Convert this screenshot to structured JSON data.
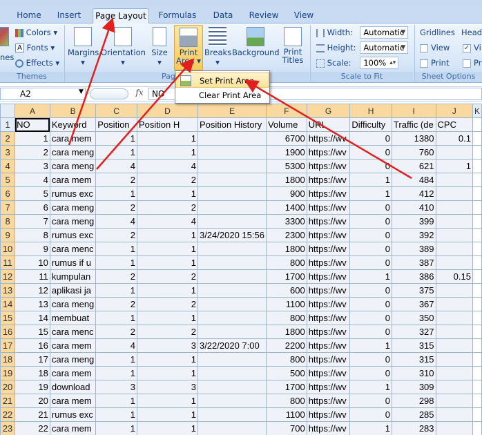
{
  "ribbon_tabs": [
    "Home",
    "Insert",
    "Page Layout",
    "Formulas",
    "Data",
    "Review",
    "View"
  ],
  "themes": {
    "partial_label": "nes",
    "colors": "Colors",
    "fonts": "Fonts",
    "effects": "Effects",
    "group": "Themes"
  },
  "page_setup": {
    "margins": "Margins",
    "orientation": "Orientation",
    "size": "Size",
    "print_area_line1": "Print",
    "print_area_line2": "Area",
    "breaks": "Breaks",
    "background": "Background",
    "print_titles_line1": "Print",
    "print_titles_line2": "Titles",
    "group_partial": "Pag"
  },
  "scale_to_fit": {
    "width_label": "Width:",
    "width_value": "Automatic",
    "height_label": "Height:",
    "height_value": "Automatic",
    "scale_label": "Scale:",
    "scale_value": "100%",
    "group": "Scale to Fit"
  },
  "sheet_options": {
    "gridlines": "Gridlines",
    "headings_partial": "Headi",
    "view": "View",
    "print": "Print",
    "view_partial": "Vi",
    "print_partial": "Pr",
    "group": "Sheet Options"
  },
  "print_area_menu": {
    "set": "Set Print Area",
    "clear": "Clear Print Area"
  },
  "formula_bar": {
    "name_box": "A2",
    "fx": "fx",
    "content": "NO"
  },
  "columns": [
    "A",
    "B",
    "C",
    "D",
    "E",
    "F",
    "G",
    "H",
    "I",
    "J",
    "K"
  ],
  "rows": [
    {
      "n": "1",
      "cells": [
        "NO",
        "Keyword",
        "Position",
        "Position H",
        "Position History",
        "Volume",
        "URL",
        "Difficulty",
        "Traffic (de",
        "CPC",
        ""
      ]
    },
    {
      "n": "2",
      "cells": [
        "1",
        "cara mem",
        "1",
        "1",
        "",
        "6700",
        "https://wv",
        "0",
        "1380",
        "0.1",
        ""
      ]
    },
    {
      "n": "3",
      "cells": [
        "2",
        "cara meng",
        "1",
        "1",
        "",
        "1900",
        "https://wv",
        "0",
        "760",
        "",
        ""
      ]
    },
    {
      "n": "4",
      "cells": [
        "3",
        "cara meng",
        "4",
        "4",
        "",
        "5300",
        "https://wv",
        "0",
        "621",
        "1",
        ""
      ]
    },
    {
      "n": "5",
      "cells": [
        "4",
        "cara mem",
        "2",
        "2",
        "",
        "1800",
        "https://wv",
        "1",
        "484",
        "",
        ""
      ]
    },
    {
      "n": "6",
      "cells": [
        "5",
        "rumus exc",
        "1",
        "1",
        "",
        "900",
        "https://wv",
        "1",
        "412",
        "",
        ""
      ]
    },
    {
      "n": "7",
      "cells": [
        "6",
        "cara meng",
        "2",
        "2",
        "",
        "1400",
        "https://wv",
        "0",
        "410",
        "",
        ""
      ]
    },
    {
      "n": "8",
      "cells": [
        "7",
        "cara meng",
        "4",
        "4",
        "",
        "3300",
        "https://wv",
        "0",
        "399",
        "",
        ""
      ]
    },
    {
      "n": "9",
      "cells": [
        "8",
        "rumus exc",
        "2",
        "1",
        "3/24/2020 15:56",
        "2300",
        "https://wv",
        "0",
        "392",
        "",
        ""
      ]
    },
    {
      "n": "10",
      "cells": [
        "9",
        "cara menc",
        "1",
        "1",
        "",
        "1800",
        "https://wv",
        "0",
        "389",
        "",
        ""
      ]
    },
    {
      "n": "11",
      "cells": [
        "10",
        "rumus if u",
        "1",
        "1",
        "",
        "800",
        "https://wv",
        "0",
        "387",
        "",
        ""
      ]
    },
    {
      "n": "12",
      "cells": [
        "11",
        "kumpulan",
        "2",
        "2",
        "",
        "1700",
        "https://wv",
        "1",
        "386",
        "0.15",
        ""
      ]
    },
    {
      "n": "13",
      "cells": [
        "12",
        "aplikasi ja",
        "1",
        "1",
        "",
        "600",
        "https://wv",
        "0",
        "375",
        "",
        ""
      ]
    },
    {
      "n": "14",
      "cells": [
        "13",
        "cara meng",
        "2",
        "2",
        "",
        "1100",
        "https://wv",
        "0",
        "367",
        "",
        ""
      ]
    },
    {
      "n": "15",
      "cells": [
        "14",
        "membuat",
        "1",
        "1",
        "",
        "800",
        "https://wv",
        "0",
        "350",
        "",
        ""
      ]
    },
    {
      "n": "16",
      "cells": [
        "15",
        "cara menc",
        "2",
        "2",
        "",
        "1800",
        "https://wv",
        "0",
        "327",
        "",
        ""
      ]
    },
    {
      "n": "17",
      "cells": [
        "16",
        "cara mem",
        "4",
        "3",
        "3/22/2020 7:00",
        "2200",
        "https://wv",
        "1",
        "315",
        "",
        ""
      ]
    },
    {
      "n": "18",
      "cells": [
        "17",
        "cara meng",
        "1",
        "1",
        "",
        "800",
        "https://wv",
        "0",
        "315",
        "",
        ""
      ]
    },
    {
      "n": "19",
      "cells": [
        "18",
        "cara mem",
        "1",
        "1",
        "",
        "500",
        "https://wv",
        "0",
        "310",
        "",
        ""
      ]
    },
    {
      "n": "20",
      "cells": [
        "19",
        "download",
        "3",
        "3",
        "",
        "1700",
        "https://wv",
        "1",
        "309",
        "",
        ""
      ]
    },
    {
      "n": "21",
      "cells": [
        "20",
        "cara mem",
        "1",
        "1",
        "",
        "800",
        "https://wv",
        "0",
        "298",
        "",
        ""
      ]
    },
    {
      "n": "22",
      "cells": [
        "21",
        "rumus exc",
        "1",
        "1",
        "",
        "1100",
        "https://wv",
        "0",
        "285",
        "",
        ""
      ]
    },
    {
      "n": "23",
      "cells": [
        "22",
        "cara mem",
        "1",
        "1",
        "",
        "700",
        "https://wv",
        "1",
        "283",
        "",
        ""
      ]
    }
  ],
  "colors": {
    "annotation_arrow": "#e0201e",
    "selection": "#f9d99f",
    "ribbon_text": "#15428b"
  }
}
